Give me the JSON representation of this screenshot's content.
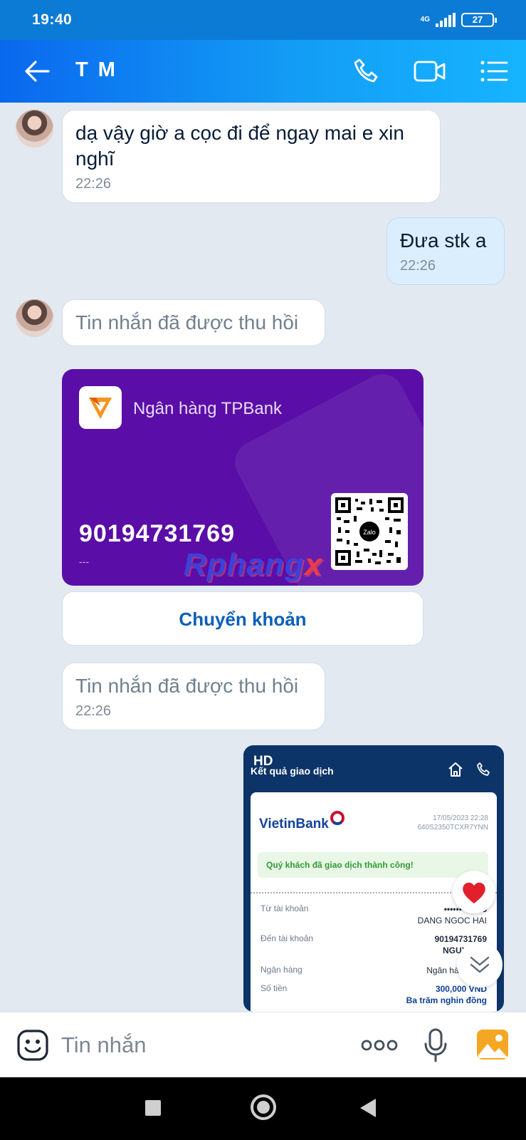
{
  "status_bar": {
    "time": "19:40",
    "network": "4G",
    "battery": "27"
  },
  "header": {
    "title": "T M"
  },
  "messages": [
    {
      "text": "dạ vậy giờ a cọc đi để ngay mai e xin nghĩ",
      "time": "22:26"
    },
    {
      "text": "Đưa stk a",
      "time": "22:26"
    },
    {
      "text": "Tin nhắn đã được thu hồi"
    },
    {
      "text": "Tin nhắn đã được thu hồi",
      "time": "22:26"
    }
  ],
  "bank_card": {
    "bank_name": "Ngân hàng TPBank",
    "account_number": "90194731769",
    "account_owner": "---",
    "qr_label": "Zalo",
    "transfer_label": "Chuyển khoản"
  },
  "watermark": {
    "main": "Rphang",
    "accent": "x"
  },
  "receipt": {
    "badge": "HD",
    "title": "Kết quả giao dịch",
    "bank": "VietinBank",
    "datetime": "17/05/2023 22:28",
    "ref": "640S2350TCXR7YNN",
    "success": "Quý khách đã giao dịch thành công!",
    "rows": [
      {
        "label": "Từ tài khoản",
        "value": "••••••••5435",
        "sub": "DANG NGOC HAI"
      },
      {
        "label": "Đến tài khoản",
        "value": "90194731769",
        "sub": "NGUYEN T"
      },
      {
        "label": "Ngân hàng",
        "value": "Ngân hàng Tiên"
      },
      {
        "label": "Số tiền",
        "value": "300,000 VND",
        "sub": "Ba trăm nghin đồng"
      }
    ]
  },
  "input": {
    "placeholder": "Tin nhắn"
  },
  "colors": {
    "header_start": "#0a68ee",
    "header_end": "#16b4ff",
    "card_purple": "#5a0ea7",
    "link_blue": "#0b5fb9"
  }
}
